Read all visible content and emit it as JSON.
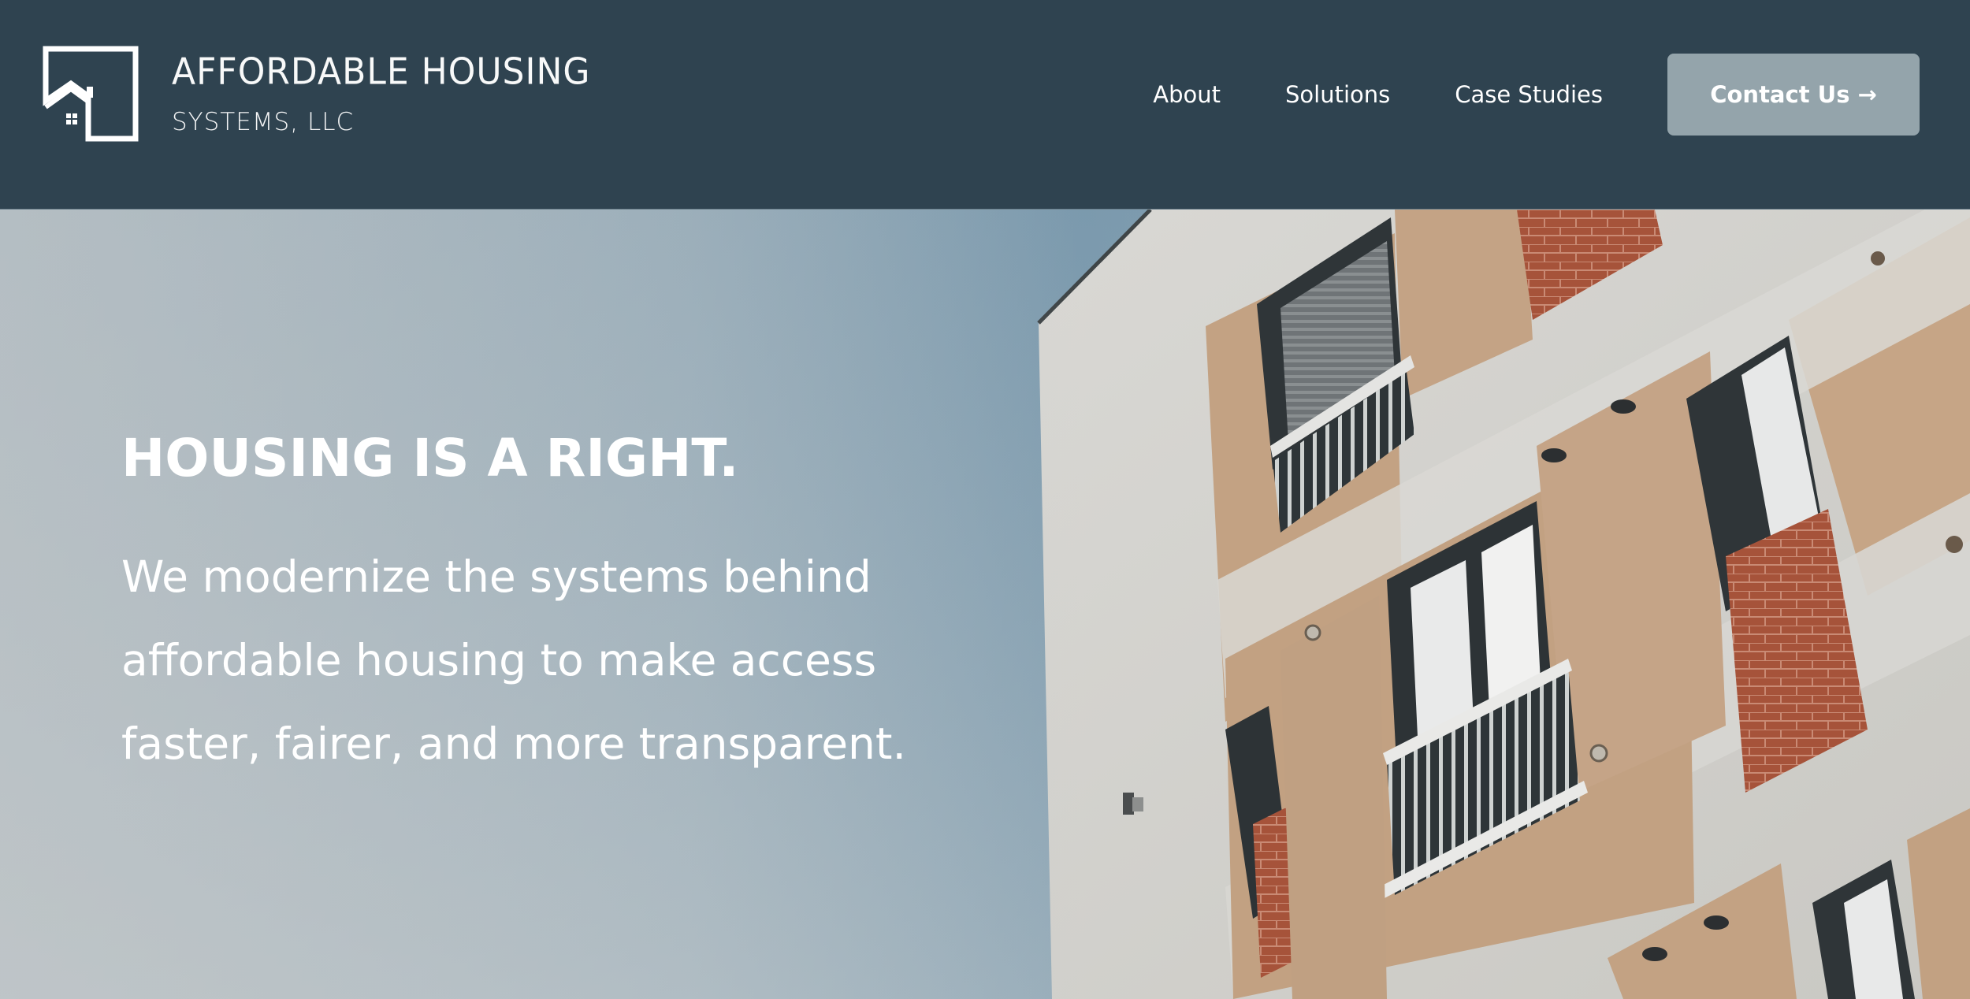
{
  "brand": {
    "line1": "AFFORDABLE HOUSING",
    "line2": "SYSTEMS, LLC",
    "logo_icon": "house-frame-icon"
  },
  "nav": {
    "items": [
      {
        "label": "About"
      },
      {
        "label": "Solutions"
      },
      {
        "label": "Case Studies"
      }
    ],
    "cta": {
      "label": "Contact Us",
      "arrow": "→"
    }
  },
  "hero": {
    "title": "HOUSING IS A RIGHT.",
    "subtitle": "We modernize the systems behind affordable housing to make access faster, fairer, and more transparent."
  },
  "colors": {
    "header_bg": "#2f4350",
    "cta_bg": "#94a4ab",
    "text": "#ffffff",
    "sky": "#8fa8b7",
    "facade_cream": "#d6d4cf",
    "facade_tan": "#c4a385",
    "brick": "#a4543c"
  }
}
